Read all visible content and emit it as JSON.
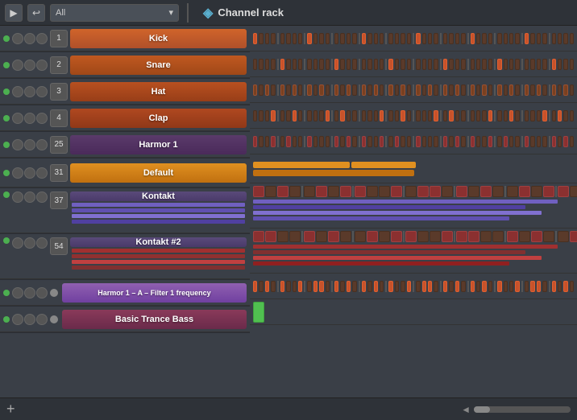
{
  "header": {
    "play_label": "▶",
    "back_label": "↩",
    "dropdown_value": "All",
    "dropdown_arrow": "▾",
    "title": "Channel rack",
    "title_icon": "◈"
  },
  "channels": [
    {
      "id": 1,
      "num": "1",
      "name": "Kick",
      "color": "kick-color",
      "type": "beat"
    },
    {
      "id": 2,
      "num": "2",
      "name": "Snare",
      "color": "snare-color",
      "type": "beat"
    },
    {
      "id": 3,
      "num": "3",
      "name": "Hat",
      "color": "hat-color",
      "type": "beat"
    },
    {
      "id": 4,
      "num": "4",
      "name": "Clap",
      "color": "clap-color",
      "type": "beat"
    },
    {
      "id": 5,
      "num": "25",
      "name": "Harmor 1",
      "color": "harmor-color",
      "type": "beat"
    },
    {
      "id": 6,
      "num": "31",
      "name": "Default",
      "color": "default-color",
      "type": "piano-single"
    },
    {
      "id": 7,
      "num": "37",
      "name": "Kontakt",
      "color": "kontakt-color",
      "type": "piano-multi-purple"
    },
    {
      "id": 8,
      "num": "54",
      "name": "Kontakt #2",
      "color": "kontakt2-color",
      "type": "piano-multi-red"
    },
    {
      "id": 9,
      "num": "—",
      "name": "Harmor 1 – A – Filter 1 frequency",
      "color": "harmor-filter-color",
      "type": "beat",
      "automation": true
    },
    {
      "id": 10,
      "num": "—",
      "name": "Basic Trance Bass",
      "color": "trance-bass-color",
      "type": "trance-bass",
      "automation": true
    }
  ],
  "bottom": {
    "add_label": "+",
    "scroll_label": "◄"
  }
}
